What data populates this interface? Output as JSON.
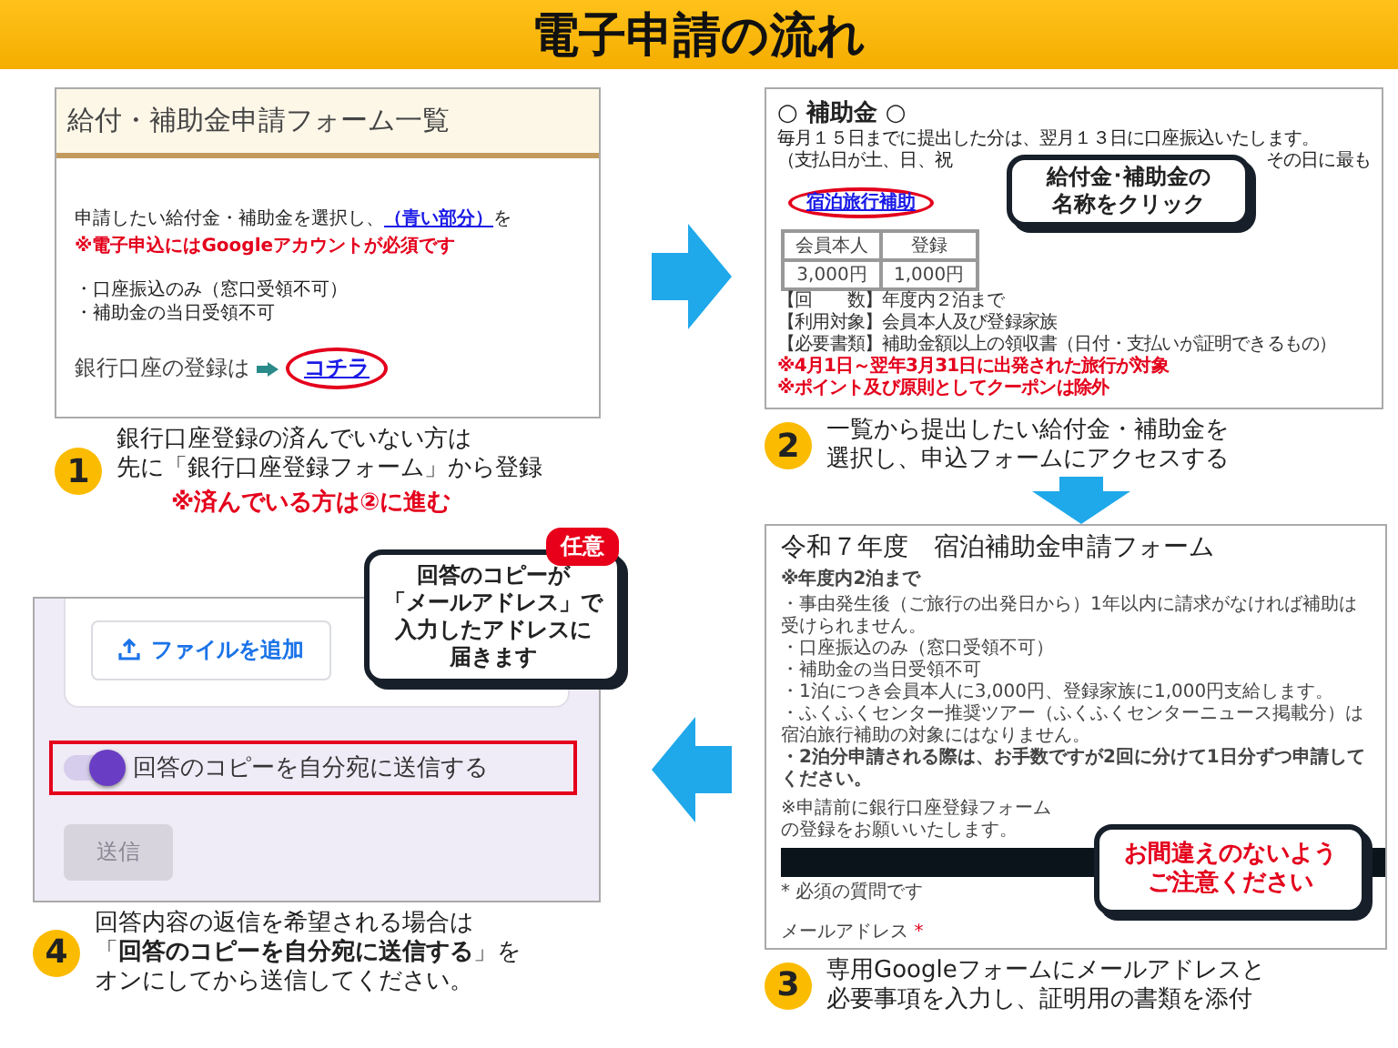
{
  "title": "電子申請の流れ",
  "step1": {
    "number": "1",
    "screen": {
      "heading": "給付・補助金申請フォーム一覧",
      "intro": "申請したい給付金・補助金を選択し、",
      "intro_link": "（青い部分）",
      "intro_tail": "を",
      "warning": "※電子申込にはGoogleアカウントが必須です",
      "bullets": [
        "・口座振込のみ（窓口受領不可）",
        "・補助金の当日受領不可"
      ],
      "bank_label": "銀行口座の登録は",
      "bank_link": "コチラ"
    },
    "caption": [
      "銀行口座登録の済んでいない方は",
      "先に「銀行口座登録フォーム」から登録"
    ],
    "note": "※済んでいる方は②に進む"
  },
  "step2": {
    "number": "2",
    "screen": {
      "heading": "○ 補助金 ○",
      "notice": "毎月１５日までに提出した分は、翌月１３日に口座振込いたします。",
      "notice_parts": [
        "（支払日が土、日、祝",
        "その日に最も"
      ],
      "link": "宿泊旅行補助",
      "table": {
        "columns": [
          "会員本人",
          "登録"
        ],
        "rows": [
          [
            "3,000円",
            "1,000円"
          ]
        ]
      },
      "details": [
        "【回　　数】年度内２泊まで",
        "【利用対象】会員本人及び登録家族",
        "【必要書類】補助金額以上の領収書（日付・支払いが証明できるもの）"
      ],
      "warnings": [
        "※4月1日～翌年3月31日に出発された旅行が対象",
        "※ポイント及び原則としてクーポンは除外"
      ]
    },
    "callout": [
      "給付金･補助金の",
      "名称をクリック"
    ],
    "caption": [
      "一覧から提出したい給付金・補助金を",
      "選択し、申込フォームにアクセスする"
    ]
  },
  "step3": {
    "number": "3",
    "screen": {
      "title": "令和７年度　宿泊補助金申請フォーム",
      "limit": "※年度内2泊まで",
      "bullets": [
        {
          "text": "・事由発生後（ご旅行の出発日から）1年以内に請求がなければ補助は受けられません。",
          "bold": false
        },
        {
          "text": "・口座振込のみ（窓口受領不可）",
          "bold": false
        },
        {
          "text": "・補助金の当日受領不可",
          "bold": false
        },
        {
          "text": "・1泊につき会員本人に3,000円、登録家族に1,000円支給します。",
          "bold": false
        },
        {
          "text": "・ふくふくセンター推奨ツアー（ふくふくセンターニュース掲載分）は宿泊旅行補助の対象にはなりません。",
          "bold": false
        },
        {
          "text": "・2泊分申請される際は、お手数ですが2回に分けて1日分ずつ申請してください。",
          "bold": true
        }
      ],
      "pre_note": [
        "※申請前に銀行口座登録フォーム",
        "の登録をお願いいたします。"
      ],
      "required_note": "* 必須の質問です",
      "email_label": "メールアドレス",
      "email_mark": "*"
    },
    "callout": [
      "お間違えのないよう",
      "ご注意ください"
    ],
    "caption": [
      "専用Googleフォームにメールアドレスと",
      "必要事項を入力し、証明用の書類を添付"
    ]
  },
  "step4": {
    "number": "4",
    "badge": "任意",
    "callout": [
      "回答のコピーが",
      "「メールアドレス」で",
      "入力したアドレスに",
      "届きます"
    ],
    "screen": {
      "upload_button": "ファイルを追加",
      "copy_toggle": {
        "label": "回答のコピーを自分宛に送信する",
        "on": true
      },
      "submit": {
        "label": "送信",
        "disabled": true
      }
    },
    "caption": [
      "回答内容の返信を希望される場合は",
      "「**回答のコピーを自分宛に送信する**」を",
      "オンにしてから送信してください。"
    ]
  }
}
